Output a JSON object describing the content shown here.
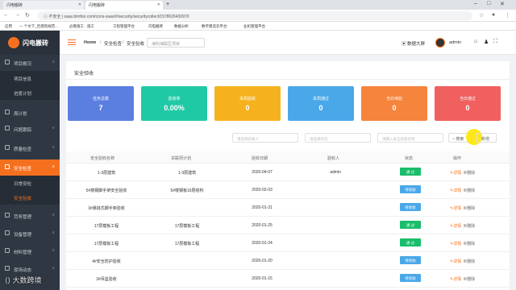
{
  "browser": {
    "tabs": [
      {
        "label": "闪电搬砖"
      },
      {
        "label": "闪电搬砖"
      }
    ],
    "url_security": "不安全",
    "url": "saas.bimfoo.com/cons-saas/#/security/securitycollect/1578626430970",
    "bookmarks": [
      "应用",
      "— 个文下_巨建筑规范...",
      "必看施工 - 施工",
      "工程管理平台",
      "闪电搬砖",
      "数据分析",
      "数字建造云平台",
      "业机管理平台"
    ]
  },
  "sidebar": {
    "logo": "闪电搬砖",
    "items": [
      {
        "label": "项目概况",
        "arrow": "∧"
      },
      {
        "label": "项目信息",
        "sub": true
      },
      {
        "label": "进度计划",
        "sub": true
      },
      {
        "label": "周计划",
        "arrow": ""
      },
      {
        "label": "问题跟踪",
        "arrow": "∨"
      },
      {
        "label": "质量检查",
        "arrow": "∨"
      },
      {
        "label": "安全检查",
        "arrow": "∧",
        "active": true
      },
      {
        "label": "日常安检",
        "sub": true
      },
      {
        "label": "安全验收",
        "sub": true,
        "active": true
      },
      {
        "label": "劳务管理",
        "arrow": "∨"
      },
      {
        "label": "设备管理",
        "arrow": "∨"
      },
      {
        "label": "材料管理",
        "arrow": "∨"
      },
      {
        "label": "现场动态",
        "arrow": "∨"
      }
    ]
  },
  "header": {
    "breadcrumb": [
      "Home",
      "安全检查",
      "安全验收"
    ],
    "segment_placeholder": "海科海联区项目",
    "data_screen": "数据大屏",
    "username": "admin"
  },
  "page": {
    "title": "安全验收",
    "stats": [
      {
        "title": "任务总数",
        "value": "7",
        "color": "#5b7fe0"
      },
      {
        "title": "验收率",
        "value": "0.00%",
        "color": "#20c9a6"
      },
      {
        "title": "本周验收",
        "value": "0",
        "color": "#f5b21e"
      },
      {
        "title": "本周通过",
        "value": "0",
        "color": "#4aa8e8"
      },
      {
        "title": "当日待验",
        "value": "0",
        "color": "#f5843c"
      },
      {
        "title": "当日通过",
        "value": "0",
        "color": "#f0605f"
      }
    ],
    "filters": {
      "person_placeholder": "请选择验收人",
      "status_placeholder": "请选择状态",
      "name_placeholder": "请输入安全验收名称",
      "search_label": "搜索",
      "add_label": "新增"
    },
    "columns": [
      "安全验收名称",
      "关联周计划",
      "验收日期",
      "验收人",
      "状态",
      "操作"
    ],
    "rows": [
      {
        "name": "1-3层建筑",
        "plan": "1-3层建筑",
        "date": "2020-04-07",
        "person": "admin",
        "status": "通 过",
        "status_color": "#19be6b"
      },
      {
        "name": "5#楼钢脚手架安全验收",
        "plan": "5#楼钢板16层结构",
        "date": "2020-02-03",
        "person": "",
        "status": "待验收",
        "status_color": "#4aa8e8"
      },
      {
        "name": "3#悬挑式脚手架验收",
        "plan": "",
        "date": "2020-01-31",
        "person": "",
        "status": "待验收",
        "status_color": "#4aa8e8"
      },
      {
        "name": "17层模板工程",
        "plan": "17层模板工程",
        "date": "2020-01-25",
        "person": "",
        "status": "通 过",
        "status_color": "#19be6b"
      },
      {
        "name": "17层模板工程",
        "plan": "17层模板工程",
        "date": "2020-01-24",
        "person": "",
        "status": "通 过",
        "status_color": "#19be6b"
      },
      {
        "name": "4#安全防护验收",
        "plan": "",
        "date": "2020-01-20",
        "person": "",
        "status": "待验收",
        "status_color": "#4aa8e8"
      },
      {
        "name": "3#吊篮验收",
        "plan": "",
        "date": "2020-01-15",
        "person": "",
        "status": "待验收",
        "status_color": "#4aa8e8"
      }
    ],
    "op_detail": "详情",
    "op_delete": "删除"
  },
  "watermark": "大数跨境"
}
